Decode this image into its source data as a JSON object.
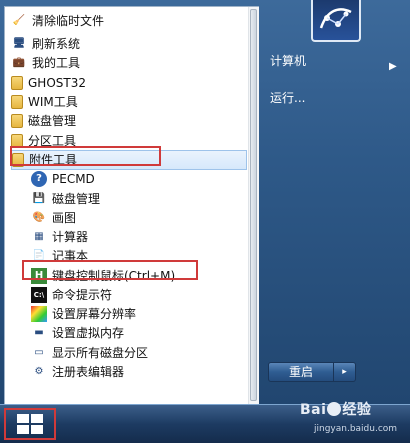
{
  "start_menu": {
    "programs": [
      {
        "label": "清除临时文件",
        "icon": "broom-icon",
        "kind": "app"
      },
      {
        "label": "刷新系统",
        "icon": "monitor-icon",
        "kind": "app"
      },
      {
        "label": "我的工具",
        "icon": "bag-icon",
        "kind": "app"
      },
      {
        "label": "GHOST32",
        "icon": "folder-icon",
        "kind": "folder"
      },
      {
        "label": "WIM工具",
        "icon": "folder-icon",
        "kind": "folder"
      },
      {
        "label": "磁盘管理",
        "icon": "folder-icon",
        "kind": "folder"
      },
      {
        "label": "分区工具",
        "icon": "folder-icon",
        "kind": "folder"
      },
      {
        "label": "附件工具",
        "icon": "folder-icon",
        "kind": "folder",
        "expanded": true
      },
      {
        "label": "PECMD",
        "icon": "help-circle-icon",
        "kind": "app"
      },
      {
        "label": "磁盘管理",
        "icon": "disk-management-icon",
        "kind": "app"
      },
      {
        "label": "画图",
        "icon": "paint-icon",
        "kind": "app"
      },
      {
        "label": "计算器",
        "icon": "calculator-icon",
        "kind": "app"
      },
      {
        "label": "记事本",
        "icon": "notepad-icon",
        "kind": "app"
      },
      {
        "label": "键盘控制鼠标(Ctrl+M)",
        "icon": "keyboard-mouse-icon",
        "kind": "app"
      },
      {
        "label": "命令提示符",
        "icon": "cmd-icon",
        "kind": "app"
      },
      {
        "label": "设置屏幕分辨率",
        "icon": "screen-resolution-icon",
        "kind": "app"
      },
      {
        "label": "设置虚拟内存",
        "icon": "memory-chip-icon",
        "kind": "app"
      },
      {
        "label": "显示所有磁盘分区",
        "icon": "drive-icon",
        "kind": "app"
      },
      {
        "label": "注册表编辑器",
        "icon": "registry-icon",
        "kind": "app"
      }
    ],
    "right_pane": {
      "computer_label": "计算机",
      "run_label": "运行..."
    },
    "shutdown": {
      "label": "重启",
      "arrow": "▸"
    }
  },
  "watermark": {
    "brand": "Bai",
    "brand_du": "经验",
    "url": "jingyan.baidu.com"
  },
  "colors": {
    "highlight_border": "#d03a3a",
    "selected_bg": "#d6e8fb",
    "menu_blue": "#2e5988"
  }
}
